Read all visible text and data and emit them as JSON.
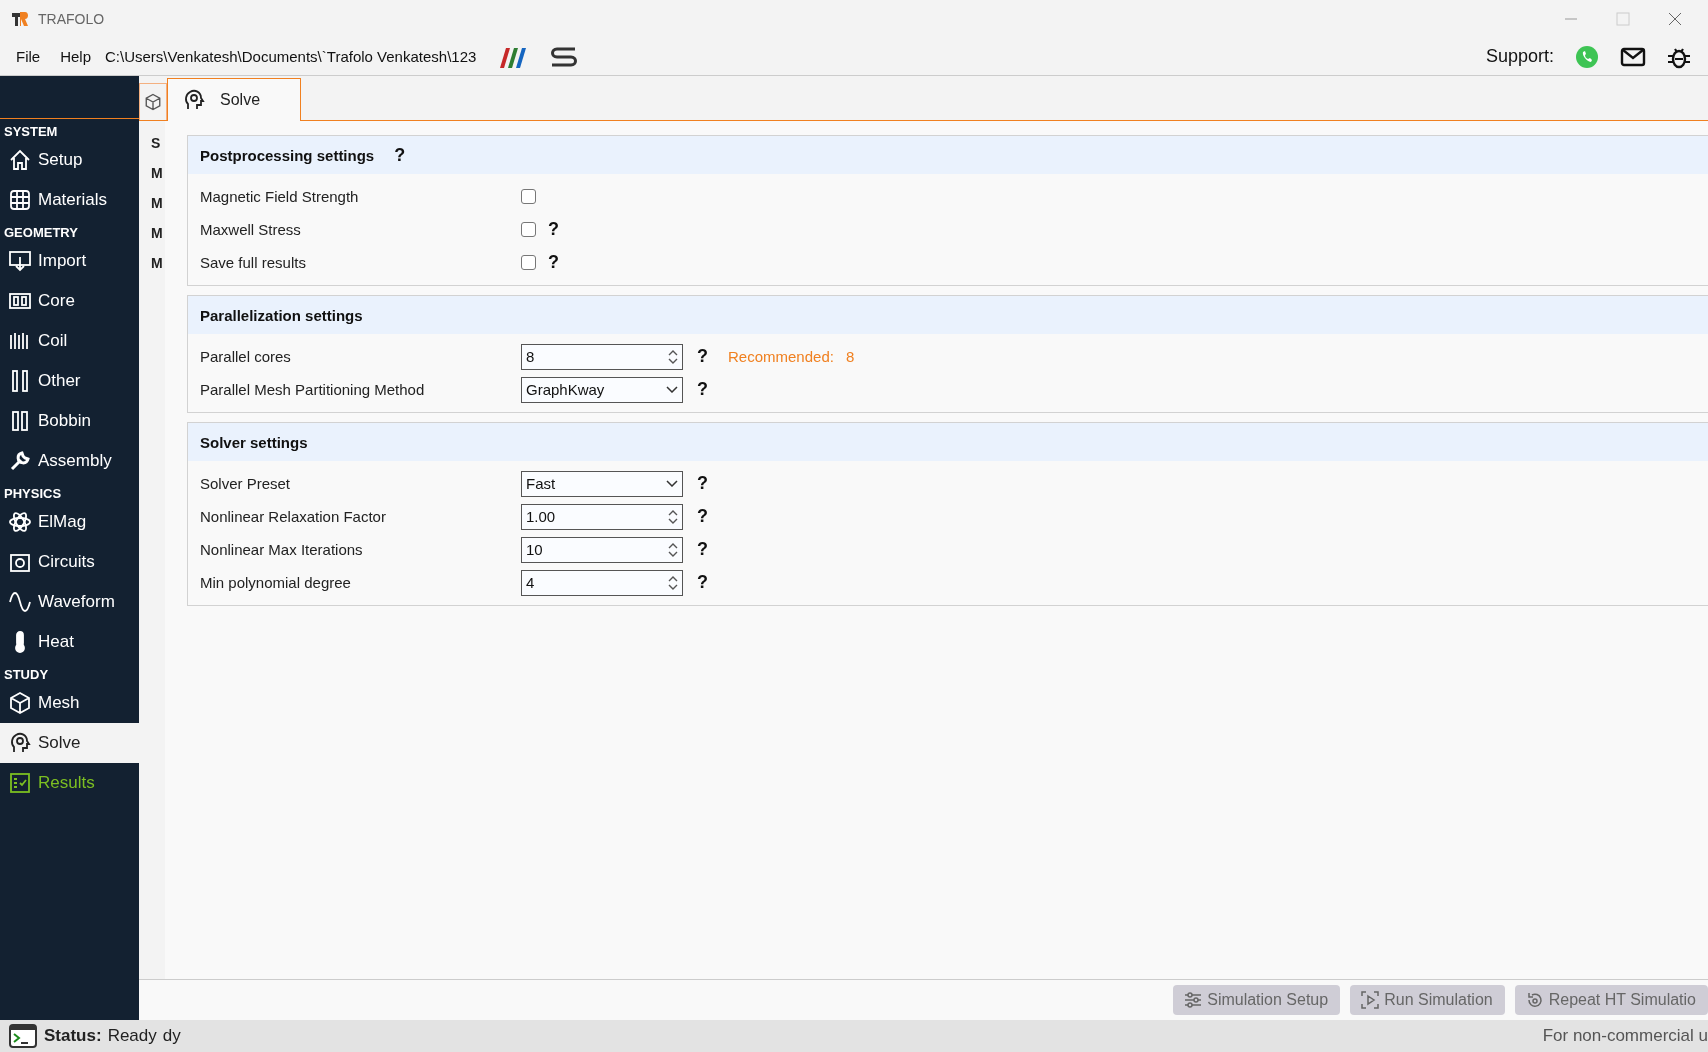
{
  "window": {
    "title": "TRAFOLO"
  },
  "menu": {
    "items": [
      "File",
      "Help"
    ],
    "path": "C:\\Users\\Venkatesh\\Documents\\`Trafolo Venkatesh\\123",
    "support_label": "Support:"
  },
  "sidebar": {
    "groups": [
      {
        "header": "SYSTEM",
        "items": [
          {
            "label": "Setup",
            "selected": false,
            "color": "#ffffff"
          },
          {
            "label": "Materials",
            "selected": false,
            "color": "#ffffff"
          }
        ]
      },
      {
        "header": "GEOMETRY",
        "items": [
          {
            "label": "Import",
            "selected": false,
            "color": "#ffffff"
          },
          {
            "label": "Core",
            "selected": false,
            "color": "#ffffff"
          },
          {
            "label": "Coil",
            "selected": false,
            "color": "#ffffff"
          },
          {
            "label": "Other",
            "selected": false,
            "color": "#ffffff"
          },
          {
            "label": "Bobbin",
            "selected": false,
            "color": "#ffffff"
          },
          {
            "label": "Assembly",
            "selected": false,
            "color": "#ffffff"
          }
        ]
      },
      {
        "header": "PHYSICS",
        "items": [
          {
            "label": "ElMag",
            "selected": false,
            "color": "#ffffff"
          },
          {
            "label": "Circuits",
            "selected": false,
            "color": "#ffffff"
          },
          {
            "label": "Waveform",
            "selected": false,
            "color": "#ffffff"
          },
          {
            "label": "Heat",
            "selected": false,
            "color": "#ffffff"
          }
        ]
      },
      {
        "header": "STUDY",
        "items": [
          {
            "label": "Mesh",
            "selected": false,
            "color": "#ffffff"
          },
          {
            "label": "Solve",
            "selected": true,
            "color": "#222222"
          },
          {
            "label": "Results",
            "selected": false,
            "color": "#7cbf22"
          }
        ]
      }
    ]
  },
  "tabs": [
    {
      "label": "Solve",
      "selected": true
    }
  ],
  "behind_panel": {
    "texts": [
      "S",
      "M",
      "M",
      "M",
      "M"
    ]
  },
  "sections": [
    {
      "title": "Postprocessing settings",
      "help": true,
      "rows": [
        {
          "kind": "checkbox",
          "label": "Magnetic Field Strength",
          "checked": false,
          "help": false
        },
        {
          "kind": "checkbox",
          "label": "Maxwell Stress",
          "checked": false,
          "help": true
        },
        {
          "kind": "checkbox",
          "label": "Save full results",
          "checked": false,
          "help": true
        }
      ]
    },
    {
      "title": "Parallelization settings",
      "help": false,
      "rows": [
        {
          "kind": "spin",
          "label": "Parallel cores",
          "value": "8",
          "help": true,
          "note_label": "Recommended:",
          "note_value": "8"
        },
        {
          "kind": "select",
          "label": "Parallel Mesh Partitioning Method",
          "value": "GraphKway",
          "help": true
        }
      ]
    },
    {
      "title": "Solver settings",
      "help": false,
      "rows": [
        {
          "kind": "select",
          "label": "Solver Preset",
          "value": "Fast",
          "help": true
        },
        {
          "kind": "spin",
          "label": "Nonlinear Relaxation Factor",
          "value": "1.00",
          "help": true
        },
        {
          "kind": "spin",
          "label": "Nonlinear Max Iterations",
          "value": "10",
          "help": true
        },
        {
          "kind": "spin",
          "label": "Min polynomial degree",
          "value": "4",
          "help": true
        }
      ]
    }
  ],
  "help_mark": "?",
  "buttons": [
    {
      "label": "Simulation Setup",
      "disabled": true
    },
    {
      "label": "Run Simulation",
      "disabled": true
    },
    {
      "label": "Repeat HT Simulatio",
      "disabled": true
    }
  ],
  "status": {
    "label": "Status:",
    "value": "Ready",
    "fragment": "dy",
    "license": "For non-commercial u"
  }
}
